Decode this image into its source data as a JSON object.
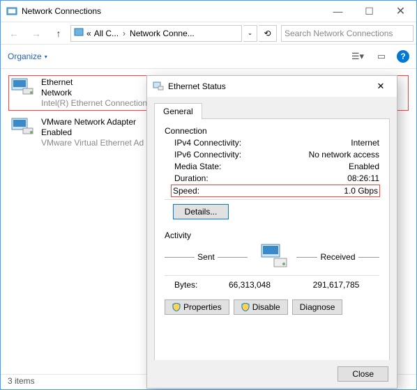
{
  "window": {
    "title": "Network Connections",
    "search_placeholder": "Search Network Connections"
  },
  "breadcrumbs": {
    "c1": "All C...",
    "c2": "Network Conne..."
  },
  "toolbar": {
    "organize": "Organize"
  },
  "connections": [
    {
      "name": "Ethernet",
      "state": "Network",
      "desc": "Intel(R) Ethernet Connection"
    },
    {
      "name": "VMware Network Adapter",
      "state": "Enabled",
      "desc": "VMware Virtual Ethernet Ad"
    }
  ],
  "status": {
    "items": "3 items"
  },
  "dialog": {
    "title": "Ethernet Status",
    "tab": "General",
    "group": "Connection",
    "rows": {
      "ipv4_l": "IPv4 Connectivity:",
      "ipv4_v": "Internet",
      "ipv6_l": "IPv6 Connectivity:",
      "ipv6_v": "No network access",
      "media_l": "Media State:",
      "media_v": "Enabled",
      "dur_l": "Duration:",
      "dur_v": "08:26:11",
      "speed_l": "Speed:",
      "speed_v": "1.0 Gbps"
    },
    "details": "Details...",
    "activity": {
      "title": "Activity",
      "sent": "Sent",
      "received": "Received",
      "bytes_l": "Bytes:",
      "sent_v": "66,313,048",
      "recv_v": "291,617,785"
    },
    "buttons": {
      "properties": "Properties",
      "disable": "Disable",
      "diagnose": "Diagnose",
      "close": "Close"
    }
  }
}
